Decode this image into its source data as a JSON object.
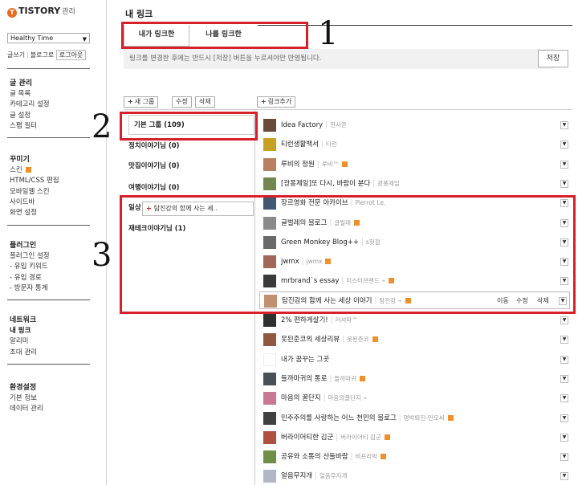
{
  "brand": {
    "logo_text": "TISTORY",
    "subtitle": "관리",
    "logo_mark": "T"
  },
  "blog_select": {
    "value": "Healthy Time"
  },
  "toplinks": {
    "write": "글쓰기",
    "blog_home": "블로그로",
    "logout": "로그아웃"
  },
  "sidebar": {
    "sections": [
      {
        "title": "글 관리",
        "items": [
          "글 목록",
          "카테고리 설정",
          "글 설정",
          "스팸 필터"
        ]
      },
      {
        "title": "꾸미기",
        "items": [
          "스킨",
          "HTML/CSS 편집",
          "모바일웹 스킨",
          "사이드바",
          "화면 설정"
        ]
      },
      {
        "title": "플러그인",
        "items": [
          "플러그인 설정",
          "- 유입 키워드",
          "- 유입 경로",
          "- 방문자 통계"
        ]
      },
      {
        "title": "네트워크",
        "items": [
          "내 링크",
          "알리미",
          "초대 관리"
        ]
      },
      {
        "title": "환경설정",
        "items": [
          "기본 정보",
          "데이터 관리"
        ]
      }
    ]
  },
  "page": {
    "title": "내 링크",
    "tabs": [
      "내가 링크한",
      "나를 링크한"
    ],
    "notice": "링크를 변경한 후에는 반드시 [저장] 버튼을 누르셔야만 반영됩니다.",
    "save": "저장",
    "new_group": "새 그룹",
    "edit": "수정",
    "delete": "삭제",
    "add_link": "링크추가"
  },
  "annotations": [
    "1",
    "2",
    "3"
  ],
  "groups": [
    {
      "name": "기본 그룹 (109)"
    },
    {
      "name": "정치이야기님 (0)"
    },
    {
      "name": "맛집이야기님 (0)"
    },
    {
      "name": "여행이야기님 (0)"
    },
    {
      "name": "일상"
    },
    {
      "name": "재테크이야기님 (1)"
    }
  ],
  "drag_item": "탐진강의 함께 사는 세..",
  "links": [
    {
      "name": "Idea Factory",
      "sub": "천사쿤",
      "badge": false,
      "cc": false,
      "color": "#6b4a3a"
    },
    {
      "name": "티런생활백서",
      "sub": "티런",
      "badge": false,
      "cc": false,
      "color": "#c8a020"
    },
    {
      "name": "루비의 정원",
      "sub": "루비™",
      "badge": true,
      "cc": false,
      "color": "#b88060"
    },
    {
      "name": "[광퐁제일]또 다시, 바람이 분다",
      "sub": "광퐁제일",
      "badge": false,
      "cc": false,
      "color": "#708850"
    },
    {
      "name": "장르영화 전문 아카이브",
      "sub": "Pierrot Le.",
      "badge": false,
      "cc": false,
      "color": "#405870"
    },
    {
      "name": "글벌레의 블로그",
      "sub": "글벌레",
      "badge": true,
      "cc": false,
      "color": "#8a8a8a"
    },
    {
      "name": "Green Monkey Blog++",
      "sub": "s헛걸",
      "badge": false,
      "cc": false,
      "color": "#6a6a6a"
    },
    {
      "name": "jwmx",
      "sub": "jwmx",
      "badge": true,
      "cc": false,
      "color": "#a06858"
    },
    {
      "name": "mrbrand`s essay",
      "sub": "미스터브랜드",
      "badge": true,
      "cc": true,
      "color": "#3a3a3a"
    },
    {
      "name": "탐진강의 함께 사는 세상 이야기",
      "sub": "탐진강",
      "badge": true,
      "cc": true,
      "color": "#c09070"
    },
    {
      "name": "2% 편하게살기!",
      "sub": "러셔파™",
      "badge": false,
      "cc": false,
      "color": "#303030"
    },
    {
      "name": "못된준코의 세상리뷰",
      "sub": "못된준코",
      "badge": true,
      "cc": false,
      "color": "#905840"
    },
    {
      "name": "내가 꿈꾸는 그곳",
      "sub": "",
      "badge": false,
      "cc": false,
      "color": "#ffffff"
    },
    {
      "name": "들까마귀의 통로",
      "sub": "들까마귀",
      "badge": true,
      "cc": false,
      "color": "#485058"
    },
    {
      "name": "마음의 꿀단지",
      "sub": "마음의꿀단지",
      "badge": false,
      "cc": true,
      "color": "#c87890"
    },
    {
      "name": "민주주의를 사랑하는 어느 천민의 블로그",
      "sub": "명박퇴진-안모씨",
      "badge": true,
      "cc": false,
      "color": "#404040"
    },
    {
      "name": "버라이어티한 김군",
      "sub": "버라이어티 김군",
      "badge": true,
      "cc": false,
      "color": "#b05040"
    },
    {
      "name": "공유와 소통의 산들바람",
      "sub": "비프리박",
      "badge": true,
      "cc": false,
      "color": "#709048"
    },
    {
      "name": "얼음무지개",
      "sub": "얼음무지개",
      "badge": false,
      "cc": false,
      "color": "#b0b8c8"
    }
  ],
  "current_row_actions": [
    "이동",
    "수정",
    "삭제"
  ],
  "colors": {
    "highlight": "#d6202a",
    "badge": "#f0902a"
  }
}
